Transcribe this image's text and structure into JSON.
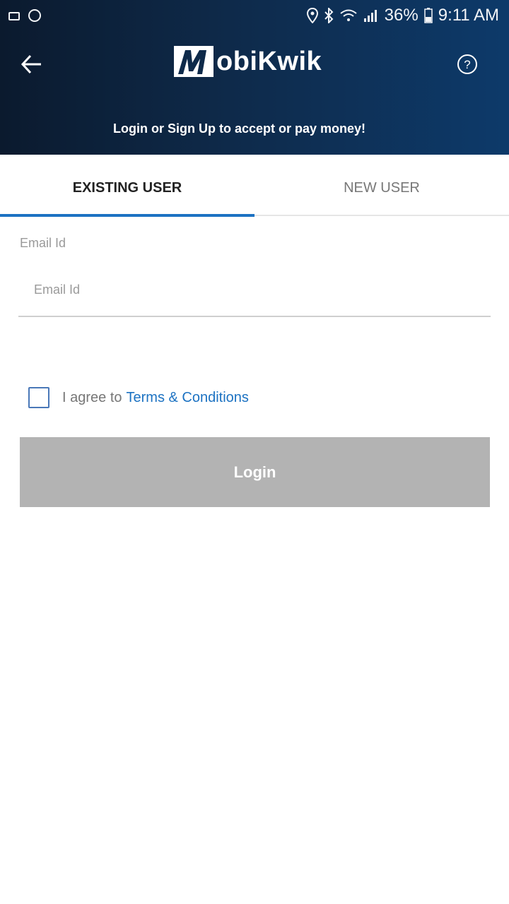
{
  "status_bar": {
    "battery": "36%",
    "time": "9:11 AM"
  },
  "header": {
    "logo_text": "obiKwik",
    "subtitle": "Login or Sign Up to accept or pay money!",
    "icons": {
      "back": "back-arrow-icon",
      "help": "help-icon"
    }
  },
  "tabs": [
    {
      "label": "EXISTING USER",
      "active": true
    },
    {
      "label": "NEW USER",
      "active": false
    }
  ],
  "form": {
    "email_label": "Email Id",
    "email_placeholder": "Email Id",
    "email_value": "",
    "agree_text": "I agree to",
    "terms_link": "Terms & Conditions",
    "checkbox_checked": false,
    "login_label": "Login"
  },
  "colors": {
    "accent": "#1c72c2",
    "button_disabled": "#b3b3b3",
    "header_dark": "#0b1a2e"
  }
}
